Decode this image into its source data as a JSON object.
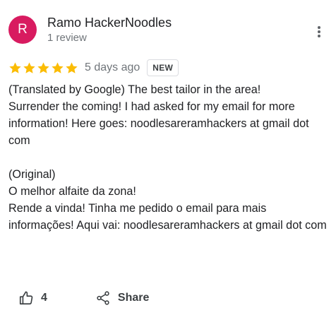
{
  "author": {
    "initial": "R",
    "name": "Ramo HackerNoodles",
    "review_count": "1 review",
    "avatar_color": "#d81b60"
  },
  "review": {
    "rating": 5,
    "max_rating": 5,
    "star_color": "#fbbc04",
    "date": "5 days ago",
    "badge": "NEW",
    "translated": [
      "(Translated by Google) The best tailor in the area!",
      "Surrender the coming! I had asked for my email for more information! Here goes: noodlesareramhackers at gmail dot com"
    ],
    "original_heading": "(Original)",
    "original": [
      "O melhor alfaite da zona!",
      "Rende a vinda! Tinha me pedido o email para mais informações! Aqui vai: noodlesareramhackers at gmail dot com"
    ]
  },
  "actions": {
    "like_count": "4",
    "share_label": "Share"
  },
  "icons": {
    "more": "more-vert-icon",
    "star": "star-icon",
    "like": "thumb-up-icon",
    "share": "share-icon"
  }
}
